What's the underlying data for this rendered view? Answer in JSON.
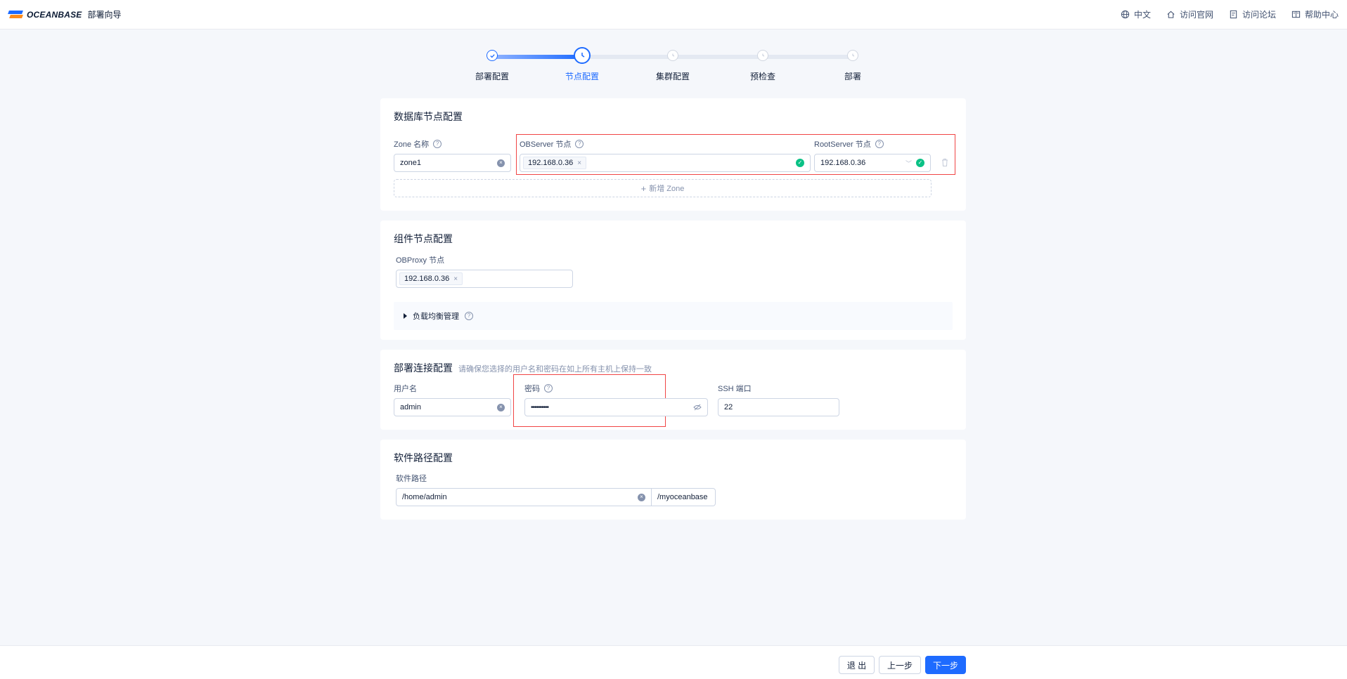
{
  "header": {
    "brand_name": "OCEANBASE",
    "brand_subtitle": "部署向导",
    "nav": [
      {
        "label": "中文",
        "icon": "globe-icon"
      },
      {
        "label": "访问官网",
        "icon": "home-icon"
      },
      {
        "label": "访问论坛",
        "icon": "forum-icon"
      },
      {
        "label": "帮助中心",
        "icon": "book-icon"
      }
    ]
  },
  "steps": [
    {
      "label": "部署配置",
      "status": "done"
    },
    {
      "label": "节点配置",
      "status": "active"
    },
    {
      "label": "集群配置",
      "status": "pending"
    },
    {
      "label": "预检查",
      "status": "pending"
    },
    {
      "label": "部署",
      "status": "pending"
    }
  ],
  "db_nodes": {
    "title": "数据库节点配置",
    "zone_label": "Zone 名称",
    "zone_value": "zone1",
    "observer_label": "OBServer 节点",
    "observer_tag": "192.168.0.36",
    "rootserver_label": "RootServer 节点",
    "rootserver_value": "192.168.0.36",
    "add_zone": "新增 Zone"
  },
  "component_nodes": {
    "title": "组件节点配置",
    "obproxy_label": "OBProxy 节点",
    "obproxy_tag": "192.168.0.36",
    "lb_label": "负载均衡管理"
  },
  "connection": {
    "title": "部署连接配置",
    "hint": "请确保您选择的用户名和密码在如上所有主机上保持一致",
    "username_label": "用户名",
    "username_value": "admin",
    "password_label": "密码",
    "password_value": "••••••••••",
    "ssh_label": "SSH 端口",
    "ssh_value": "22"
  },
  "software_path": {
    "title": "软件路径配置",
    "label": "软件路径",
    "value": "/home/admin",
    "suffix": "/myoceanbase"
  },
  "footer": {
    "exit": "退 出",
    "prev": "上一步",
    "next": "下一步"
  },
  "colors": {
    "primary": "#1e6bff",
    "success": "#0ac185",
    "highlight": "#f04545"
  }
}
